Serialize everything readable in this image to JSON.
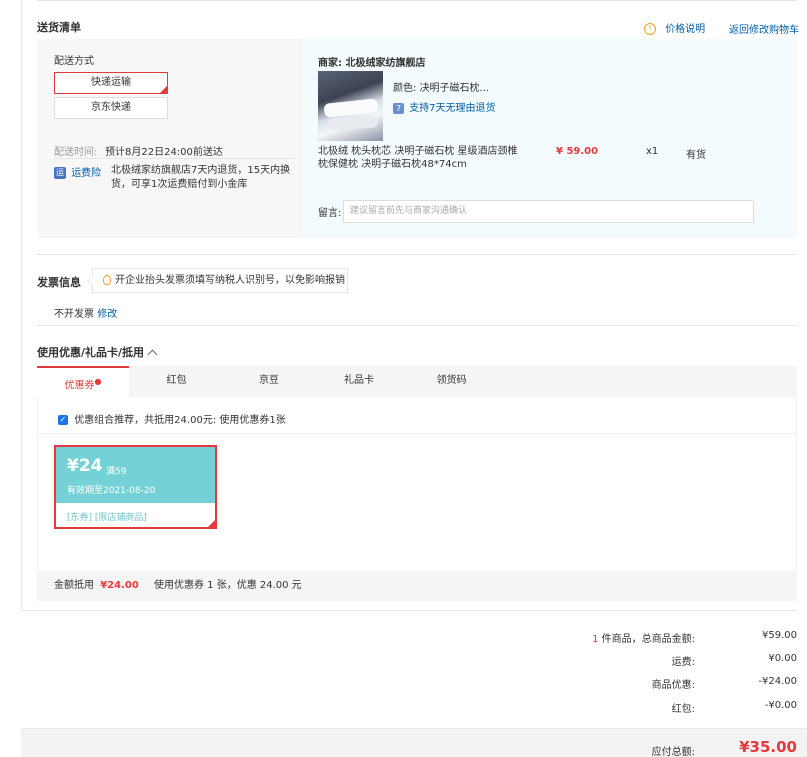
{
  "delivery": {
    "title": "送货清单",
    "price_note": "价格说明",
    "back_to_cart": "返回修改购物车",
    "method_label": "配送方式",
    "methods": [
      "快递运输",
      "京东快递"
    ],
    "time_label": "配送时间:",
    "time_value": "预计8月22日24:00前送达",
    "insurance_icon_text": "运",
    "insurance_label": "运费险",
    "insurance_desc_line1": "北极绒家纺旗舰店7天内退货，15天内换",
    "insurance_desc_line2": "货，可享1次运费赔付到小金库"
  },
  "product": {
    "merchant_label": "商家:",
    "merchant_name": "北极绒家纺旗舰店",
    "color_label": "颜色:",
    "color_value": "决明子磁石枕...",
    "return_icon_text": "7",
    "return_policy": "支持7天无理由退货",
    "name_line1": "北极绒 枕头枕芯 决明子磁石枕 星级酒店颈椎",
    "name_line2": "枕保健枕 决明子磁石枕48*74cm",
    "price": "¥ 59.00",
    "qty": "x1",
    "stock": "有货",
    "note_label": "留言:",
    "note_placeholder": "建议留言前先与商家沟通确认"
  },
  "invoice": {
    "title": "发票信息",
    "tip": "开企业抬头发票须填写纳税人识别号，以免影响报销",
    "current": "不开发票",
    "modify": "修改"
  },
  "coupons": {
    "title": "使用优惠/礼品卡/抵用",
    "tabs": [
      "优惠券",
      "红包",
      "京豆",
      "礼品卡",
      "领货码"
    ],
    "active_tab_mark": "●",
    "check_mark": "✓",
    "recommend_text": "优惠组合推荐，共抵用24.00元: 使用优惠券1张",
    "card": {
      "amount": "¥24",
      "condition": "满59",
      "valid": "有效期至2021-08-20",
      "tags": "[东券] [限店铺商品]"
    },
    "summary_label": "金额抵用",
    "summary_amount": "¥24.00",
    "summary_desc": "使用优惠券 1 张，优惠 24.00 元"
  },
  "totals": {
    "count": "1",
    "count_label": "件商品，总商品金额:",
    "goods_amount": "¥59.00",
    "freight_label": "运费:",
    "freight": "¥0.00",
    "discount_label": "商品优惠:",
    "discount": "-¥24.00",
    "redpack_label": "红包:",
    "redpack": "-¥0.00",
    "payable_label": "应付总额:",
    "payable": "¥35.00"
  },
  "colors": {
    "accent": "#e4393c",
    "link": "#005ea7",
    "coupon_bg": "#74d2d7"
  }
}
